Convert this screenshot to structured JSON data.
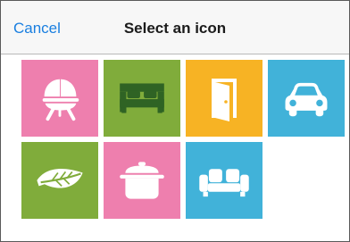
{
  "navbar": {
    "cancel_label": "Cancel",
    "title": "Select an icon"
  },
  "colors": {
    "accent": "#1a7fe0",
    "pink": "#ee7fae",
    "green": "#80ac3b",
    "yellow": "#f7b324",
    "blue": "#41b2d9"
  },
  "icons": [
    {
      "name": "stroller-icon",
      "color": "pink"
    },
    {
      "name": "bed-icon",
      "color": "green"
    },
    {
      "name": "door-icon",
      "color": "yellow"
    },
    {
      "name": "car-icon",
      "color": "blue"
    },
    {
      "name": "leaf-icon",
      "color": "green"
    },
    {
      "name": "cooking-pot-icon",
      "color": "pink"
    },
    {
      "name": "sofa-icon",
      "color": "blue"
    }
  ]
}
